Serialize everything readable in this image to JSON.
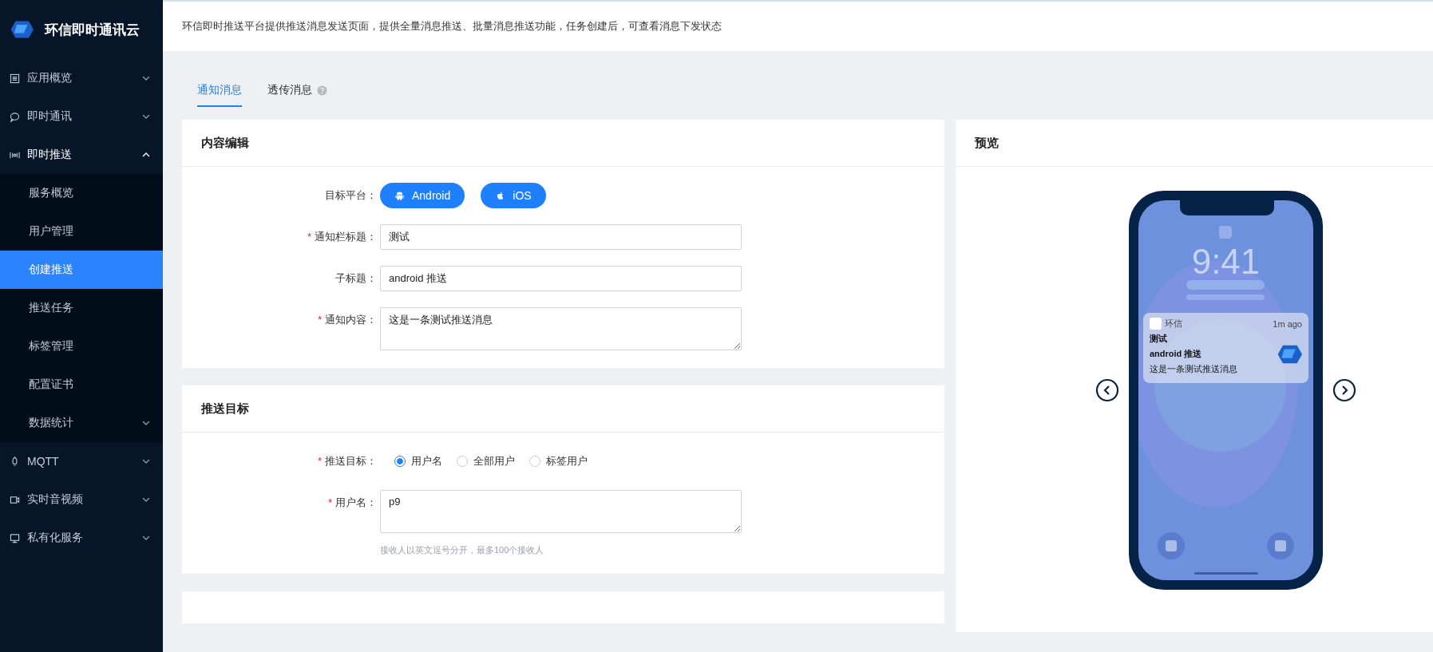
{
  "brand": {
    "name": "环信即时通讯云"
  },
  "sidebar": {
    "items": [
      {
        "label": "应用概览",
        "kind": "overview",
        "expanded": false,
        "selected": false
      },
      {
        "label": "即时通讯",
        "kind": "chat",
        "expanded": false,
        "selected": false
      },
      {
        "label": "即时推送",
        "kind": "push",
        "expanded": true,
        "selected": false,
        "children": [
          {
            "label": "服务概览",
            "selected": false
          },
          {
            "label": "用户管理",
            "selected": false
          },
          {
            "label": "创建推送",
            "selected": true
          },
          {
            "label": "推送任务",
            "selected": false
          },
          {
            "label": "标签管理",
            "selected": false
          },
          {
            "label": "配置证书",
            "selected": false
          },
          {
            "label": "数据统计",
            "selected": false,
            "expanded": false
          }
        ]
      },
      {
        "label": "MQTT",
        "kind": "rocket",
        "expanded": false,
        "selected": false
      },
      {
        "label": "实时音视频",
        "kind": "video",
        "expanded": false,
        "selected": false
      },
      {
        "label": "私有化服务",
        "kind": "monitor",
        "expanded": false,
        "selected": false
      }
    ]
  },
  "description": "环信即时推送平台提供推送消息发送页面，提供全量消息推送、批量消息推送功能，任务创建后，可查看消息下发状态",
  "tabs": [
    {
      "label": "通知消息",
      "selected": true,
      "help": false
    },
    {
      "label": "透传消息",
      "selected": false,
      "help": true
    }
  ],
  "content_card": {
    "title": "内容编辑",
    "fields": [
      {
        "kind": "platforms",
        "label": "目标平台：",
        "buttons": [
          {
            "label": "Android",
            "kind": "android"
          },
          {
            "label": "iOS",
            "kind": "apple"
          }
        ]
      },
      {
        "kind": "input",
        "label": "通知栏标题：",
        "required_mark": "*",
        "value": "测试"
      },
      {
        "kind": "input",
        "label": "子标题：",
        "value": "android 推送"
      },
      {
        "kind": "textarea",
        "label": "通知内容：",
        "required_mark": "*",
        "value": "这是一条测试推送消息"
      }
    ]
  },
  "target_card": {
    "title": "推送目标",
    "fields": [
      {
        "kind": "radios",
        "label": "推送目标：",
        "required_mark": "*",
        "options": [
          {
            "label": "用户名",
            "selected": true
          },
          {
            "label": "全部用户",
            "selected": false
          },
          {
            "label": "标签用户",
            "selected": false
          }
        ]
      },
      {
        "kind": "textarea",
        "label": "用户名：",
        "required_mark": "*",
        "value": "p9",
        "hint": "接收人以英文逗号分开，最多100个接收人"
      }
    ]
  },
  "preview": {
    "title": "预览",
    "clock": "9:41",
    "notification": {
      "app": "环信",
      "time": "1m ago",
      "title": "测试",
      "subtitle": "android 推送",
      "body": "这是一条测试推送消息"
    }
  }
}
